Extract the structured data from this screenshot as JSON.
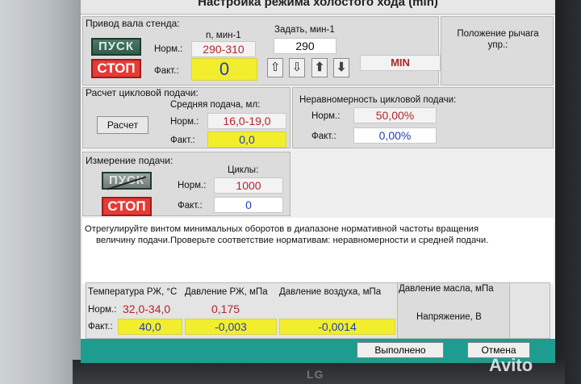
{
  "window": {
    "title": "Настройка режима холостого хода (min)"
  },
  "shaft_drive": {
    "header": "Привод вала стенда:",
    "start_label": "ПУСК",
    "stop_label": "СТОП",
    "rpm_header": "n, мин-1",
    "set_header": "Задать, мин-1",
    "lever_header": "Положение рычага упр.:",
    "norm_label": "Норм.:",
    "fact_label": "Факт.:",
    "norm_value": "290-310",
    "fact_value": "0",
    "set_value": "290",
    "lever_value": "MIN",
    "arrows": [
      "up-icon",
      "down-icon",
      "up-bold-icon",
      "down-bold-icon"
    ]
  },
  "cyclic_feed": {
    "header": "Расчет цикловой подачи:",
    "calc_button": "Расчет",
    "avg_header": "Средняя подача, мл:",
    "uneven_header": "Неравномерность цикловой подачи:",
    "norm_label": "Норм.:",
    "fact_label": "Факт.:",
    "avg_norm": "16,0-19,0",
    "avg_fact": "0,0",
    "uneven_norm": "50,00%",
    "uneven_fact": "0,00%"
  },
  "feed_measure": {
    "header": "Измерение подачи:",
    "start_label": "ПУСК",
    "stop_label": "СТОП",
    "cycles_header": "Циклы:",
    "norm_label": "Норм.:",
    "fact_label": "Факт.:",
    "cycles_norm": "1000",
    "cycles_fact": "0"
  },
  "message": {
    "line1": "Отрегулируйте винтом минимальных оборотов в диапазоне нормативной частоты вращения",
    "line2": "величину подачи.Проверьте соответствие нормативам: неравномерности и средней подачи."
  },
  "params": {
    "temp_header": "Температура РЖ, °С",
    "pressure_header": "Давление РЖ, мПа",
    "air_header": "Давление воздуха, мПа",
    "oil_header": "Давление масла, мПа",
    "voltage_header": "Напряжение, В",
    "norm_label": "Норм.:",
    "fact_label": "Факт.:",
    "temp_norm": "32,0-34,0",
    "temp_fact": "40,0",
    "pressure_norm": "0,175",
    "pressure_fact": "-0,003",
    "air_fact": "-0,0014"
  },
  "footer": {
    "done_button": "Выполнено",
    "cancel_button": "Отмена"
  },
  "monitor": {
    "brand": "LG",
    "watermark": "Avito"
  },
  "colors": {
    "accent_teal": "#1f9c90",
    "value_red": "#b3242a",
    "value_blue": "#1e3fb0",
    "field_yellow": "#f2ee2e",
    "stop_red": "#e63a35"
  }
}
